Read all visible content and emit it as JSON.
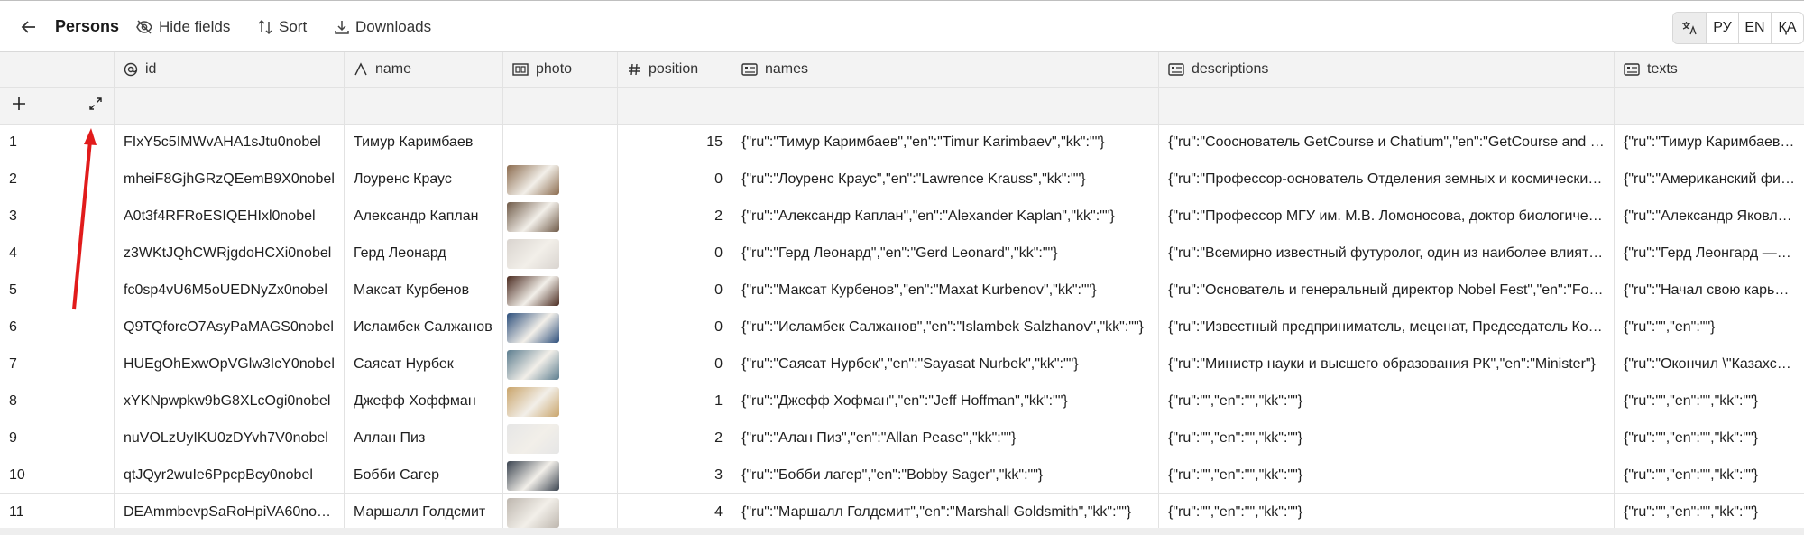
{
  "toolbar": {
    "title": "Persons",
    "hide_fields": "Hide fields",
    "sort": "Sort",
    "downloads": "Downloads",
    "languages": [
      "РУ",
      "EN",
      "ҚА"
    ]
  },
  "columns": [
    {
      "label": "id",
      "icon": "at-icon"
    },
    {
      "label": "name",
      "icon": "text-type-icon"
    },
    {
      "label": "photo",
      "icon": "image-gallery-icon"
    },
    {
      "label": "position",
      "icon": "hash-icon"
    },
    {
      "label": "names",
      "icon": "card-icon"
    },
    {
      "label": "descriptions",
      "icon": "card-icon"
    },
    {
      "label": "texts",
      "icon": "card-icon"
    }
  ],
  "rows": [
    {
      "n": "1",
      "id": "FIxY5c5IMWvAHA1sJtu0nobel",
      "name": "Тимур Каримбаев",
      "photo": "",
      "position": "15",
      "names": "{\"ru\":\"Тимур Каримбаев\",\"en\":\"Timur Karimbaev\",\"kk\":\"\"}",
      "descriptions": "{\"ru\":\"Сооснователь GetCourse и Chatium\",\"en\":\"GetCourse and Chatium co-founder\"}",
      "texts": "{\"ru\":\"Тимур Каримбаев является сооснователем\"}"
    },
    {
      "n": "2",
      "id": "mheiF8GjhGRzQEemB9X0nobel",
      "name": "Лоуренс Краус",
      "photo": "#8b6b4e",
      "position": "0",
      "names": "{\"ru\":\"Лоуренс Краус\",\"en\":\"Lawrence Krauss\",\"kk\":\"\"}",
      "descriptions": "{\"ru\":\"Профессор-основатель Отделения земных и космических исследований\"}",
      "texts": "{\"ru\":\"Американский физик-теоретик\"}"
    },
    {
      "n": "3",
      "id": "A0t3f4RFRoESIQEHIxl0nobel",
      "name": "Александр Каплан",
      "photo": "#6f5a48",
      "position": "2",
      "names": "{\"ru\":\"Александр Каплан\",\"en\":\"Alexander Kaplan\",\"kk\":\"\"}",
      "descriptions": "{\"ru\":\"Профессор МГУ им. М.В. Ломоносова, доктор биологических наук\"}",
      "texts": "{\"ru\":\"Александр Яковлевич Каплан\"}"
    },
    {
      "n": "4",
      "id": "z3WKtJQhCWRjgdoHCXi0nobel",
      "name": "Герд Леонард",
      "photo": "#d9d4cf",
      "position": "0",
      "names": "{\"ru\":\"Герд Леонард\",\"en\":\"Gerd Leonard\",\"kk\":\"\"}",
      "descriptions": "{\"ru\":\"Всемирно известный футуролог, один из наиболее влиятельных\"}",
      "texts": "{\"ru\":\"Герд Леонгард — широко известный\"}"
    },
    {
      "n": "5",
      "id": "fc0sp4vU6M5oUEDNyZx0nobel",
      "name": "Максат Курбенов",
      "photo": "#4a2a1f",
      "position": "0",
      "names": "{\"ru\":\"Максат Курбенов\",\"en\":\"Maxat Kurbenov\",\"kk\":\"\"}",
      "descriptions": "{\"ru\":\"Основатель и генеральный директор Nobel Fest\",\"en\":\"Founder\"}",
      "texts": "{\"ru\":\"Начал свою карьеру в\"}"
    },
    {
      "n": "6",
      "id": "Q9TQforcO7AsyPaMAGS0nobel",
      "name": "Исламбек Салжанов",
      "photo": "#2d4f7c",
      "position": "0",
      "names": "{\"ru\":\"Исламбек Салжанов\",\"en\":\"Islambek Salzhanov\",\"kk\":\"\"}",
      "descriptions": "{\"ru\":\"Известный предприниматель, меценат, Председатель Комитета\"}",
      "texts": "{\"ru\":\"\",\"en\":\"\"}"
    },
    {
      "n": "7",
      "id": "HUEgOhExwOpVGlw3IcY0nobel",
      "name": "Саясат Нурбек",
      "photo": "#5c7d8f",
      "position": "0",
      "names": "{\"ru\":\"Саясат Нурбек\",\"en\":\"Sayasat Nurbek\",\"kk\":\"\"}",
      "descriptions": "{\"ru\":\"Министр науки и высшего образования РК\",\"en\":\"Minister\"}",
      "texts": "{\"ru\":\"Окончил \\\"Казахско-Турецкий\"}"
    },
    {
      "n": "8",
      "id": "xYKNpwpkw9bG8XLcOgi0nobel",
      "name": "Джефф Хоффман",
      "photo": "#c9a46a",
      "position": "1",
      "names": "{\"ru\":\"Джефф Хофман\",\"en\":\"Jeff Hoffman\",\"kk\":\"\"}",
      "descriptions": "{\"ru\":\"\",\"en\":\"\",\"kk\":\"\"}",
      "texts": "{\"ru\":\"\",\"en\":\"\",\"kk\":\"\"}"
    },
    {
      "n": "9",
      "id": "nuVOLzUyIKU0zDYvh7V0nobel",
      "name": "Аллан Пиз",
      "photo": "#e6e6e6",
      "position": "2",
      "names": "{\"ru\":\"Алан Пиз\",\"en\":\"Allan Pease\",\"kk\":\"\"}",
      "descriptions": "{\"ru\":\"\",\"en\":\"\",\"kk\":\"\"}",
      "texts": "{\"ru\":\"\",\"en\":\"\",\"kk\":\"\"}"
    },
    {
      "n": "10",
      "id": "qtJQyr2wuIe6PpcpBcy0nobel",
      "name": "Бобби Сагер",
      "photo": "#3b4450",
      "position": "3",
      "names": "{\"ru\":\"Бобби лагер\",\"en\":\"Bobby Sager\",\"kk\":\"\"}",
      "descriptions": "{\"ru\":\"\",\"en\":\"\",\"kk\":\"\"}",
      "texts": "{\"ru\":\"\",\"en\":\"\",\"kk\":\"\"}"
    },
    {
      "n": "11",
      "id": "DEAmmbevpSaRoHpiVA60nobel",
      "name": "Маршалл Голдсмит",
      "photo": "#bdb6ae",
      "position": "4",
      "names": "{\"ru\":\"Маршалл Голдсмит\",\"en\":\"Marshall Goldsmith\",\"kk\":\"\"}",
      "descriptions": "{\"ru\":\"\",\"en\":\"\",\"kk\":\"\"}",
      "texts": "{\"ru\":\"\",\"en\":\"\",\"kk\":\"\"}"
    }
  ],
  "annotation": {
    "color": "#e11b1b"
  }
}
